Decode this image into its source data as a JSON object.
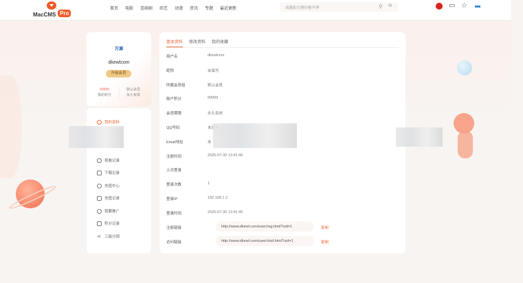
{
  "header": {
    "logo_text": "MacCMS",
    "logo_badge": "Pro",
    "nav": [
      "首页",
      "电影",
      "连续剧",
      "综艺",
      "动漫",
      "资讯",
      "专题",
      "最近更新"
    ],
    "search_placeholder": "海量影片随你看不停"
  },
  "profile": {
    "avatar_text": "万源",
    "username": "dkewlcom",
    "upgrade_label": "升级会员",
    "points_value": "99999",
    "points_label": "我的积分",
    "group_value": "默认会员",
    "group_label": "永久有效"
  },
  "menu": [
    {
      "label": "我的资料",
      "icon": "user-icon",
      "active": true
    },
    {
      "label": "观看记录",
      "icon": "clock-icon"
    },
    {
      "label": "下载记录",
      "icon": "download-icon"
    },
    {
      "label": "充值中心",
      "icon": "wallet-icon"
    },
    {
      "label": "充值记录",
      "icon": "record-icon"
    },
    {
      "label": "我要推广",
      "icon": "share-icon"
    },
    {
      "label": "积分记录",
      "icon": "coins-icon"
    },
    {
      "label": "三级分销",
      "icon": "network-icon"
    }
  ],
  "tabs": [
    "基本资料",
    "修改资料",
    "我的收藏"
  ],
  "rows": [
    {
      "k": "用户名",
      "v": "dkewlcom"
    },
    {
      "k": "昵称",
      "v": "未填写"
    },
    {
      "k": "所属会员组",
      "v": "默认会员"
    },
    {
      "k": "账户积分",
      "v": "99999"
    },
    {
      "k": "会员期限",
      "v": "永久有效"
    },
    {
      "k": "QQ号码",
      "v": "未填写"
    },
    {
      "k": "Email地址",
      "v": "未"
    },
    {
      "k": "注册时间",
      "v": "2025-07-30 13:42:49"
    },
    {
      "k": "上次登录",
      "v": ""
    },
    {
      "k": "登录次数",
      "v": "1"
    },
    {
      "k": "登录IP",
      "v": "192.168.1.3"
    },
    {
      "k": "登录时间",
      "v": "2025-07-30 13:42:49"
    }
  ],
  "links": [
    {
      "k": "注册链接",
      "v": "http://www.dkewl.com/user/reg.html?uid=1",
      "copy": "复制"
    },
    {
      "k": "访问链接",
      "v": "http://www.dkewl.com/user/visit.html?uid=1",
      "copy": "复制"
    }
  ],
  "colors": {
    "accent": "#f06a3a"
  }
}
